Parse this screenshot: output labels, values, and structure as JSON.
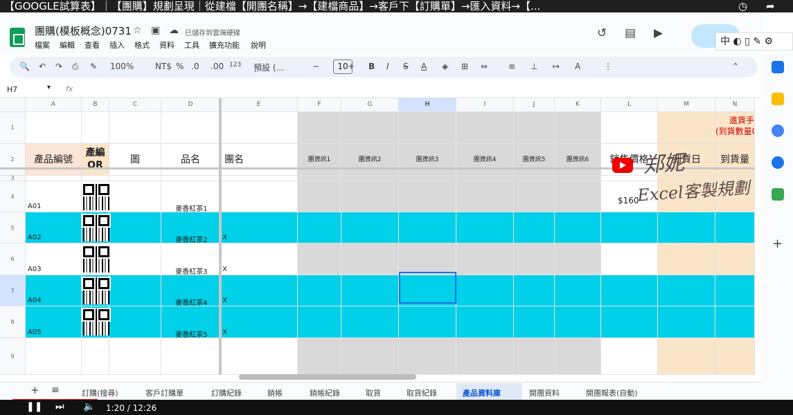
{
  "video_title": "【GOOGLE試算表】｜【團購】規劃呈現｜從建檔【開團名稱】→【建檔商品】→客戶下【訂購單】→匯入資料→【...",
  "doc": {
    "title": "團購(模板概念)0731",
    "saved_status": "已儲存到雲端硬碟",
    "menus": [
      "檔案",
      "編輯",
      "查看",
      "插入",
      "格式",
      "資料",
      "工具",
      "擴充功能",
      "說明"
    ]
  },
  "toolbar": {
    "zoom": "100%",
    "currency": "NT$",
    "percent": "%",
    "dec_less": ".0",
    "dec_more": ".00",
    "num123": "123",
    "font": "預設 (...",
    "font_size": "10",
    "bold": "B",
    "italic": "I",
    "strike": "S",
    "textcolor": "A"
  },
  "ime": "中",
  "namebox": "H7",
  "fx": "fx",
  "columns": [
    "A",
    "B",
    "C",
    "D",
    "E",
    "F",
    "G",
    "H",
    "I",
    "J",
    "K",
    "L",
    "M",
    "N"
  ],
  "rows": [
    "1",
    "2",
    "3",
    "4",
    "5",
    "6",
    "7",
    "8",
    "9"
  ],
  "headers": {
    "a": "產品編號",
    "b": "產編\nQR",
    "c": "圖",
    "d": "品名",
    "e": "團名",
    "f": "團資訊1",
    "g": "團資訊2",
    "h": "團資訊3",
    "i": "團資訊4",
    "j": "團資訊5",
    "k": "團資訊6",
    "l": "銷售價格",
    "m": "到貨日",
    "n": "到貨量",
    "n_top": "進貨手",
    "n_top2": "(到貨數量0"
  },
  "products": [
    {
      "id": "A01",
      "name": "麥香紅茶1",
      "group": "",
      "price": "$160"
    },
    {
      "id": "A02",
      "name": "麥香紅茶2",
      "group": "X",
      "price": ""
    },
    {
      "id": "A03",
      "name": "麥香紅茶3",
      "group": "X",
      "price": ""
    },
    {
      "id": "A04",
      "name": "麥香紅茶4",
      "group": "X",
      "price": ""
    },
    {
      "id": "A05",
      "name": "麥香紅茶5",
      "group": "X",
      "price": ""
    }
  ],
  "watermark": {
    "line1": "郑妮",
    "line2": "Excel客製規劃"
  },
  "sheet_tabs": [
    "訂購(搜尋)",
    "客戶訂購單",
    "訂購紀錄",
    "銷帳",
    "銷帳紀錄",
    "取貨",
    "取貨紀錄",
    "產品資料庫",
    "開團資料",
    "開團報表(自動)"
  ],
  "active_tab": "產品資料庫",
  "player": {
    "time": "1:20 / 12:26"
  },
  "colors": {
    "cyan": "#00d0e8",
    "gray": "#d9d9d9",
    "peach": "#fce4d6",
    "tan": "#fbe5c8",
    "selection": "#1a73e8"
  }
}
